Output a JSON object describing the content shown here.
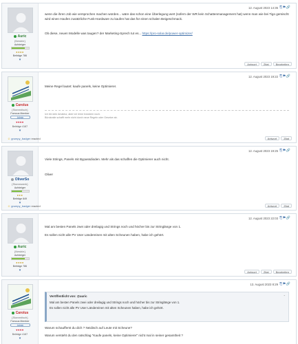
{
  "posts": [
    {
      "username": "Auric",
      "status_color": "#2e9e3b",
      "user_title": "{Newbie}",
      "rank_label": "Aufsteiger",
      "rank_fill": 0.75,
      "level": "Beiträge 786",
      "date": "12. August 2023 14:35",
      "text1": "wenn die ihren Job wie versprochen machen würden... wäre das schon eine Überlegung wert (sofern der WR kein Schattenmanagement hat) wenn man wie bei Tigo gemischt wird einen Haufen zusätzliche Funk-Hardware zu kaufen hat das für einen schalen Beigeschmack.",
      "text2": "Ob diese, neuen Modelle was taugen? der Marketing-Sprech tut es...",
      "link": "https://pro-solar.de/power-optimizer/",
      "actions": [
        "Antwort",
        "Zitat",
        "Bearbeiten"
      ]
    },
    {
      "username": "Carolus",
      "status_color": "#2e9e3b",
      "user_title": "{Stammtisch}",
      "rank_label": "Famous Member",
      "badge": "Admin",
      "level": "Beiträge 4187",
      "date": "12. August 2023 19:22",
      "text1": "Meine Regel lautet: kaufe panels, keine Optimierer.",
      "sig1": "Ich bin kein Amateur, aber ich lerne trotzdem noch.",
      "sig2": "Bürokratie schafft mehr nicht durch neue Regeln oder Gesetze ab.",
      "reacted_user": "grumpy_badger",
      "reacted_text": "reacted",
      "actions": [
        "Antwort",
        "Zitat"
      ]
    },
    {
      "username": "OliverSo",
      "status_color": "#9aa0a6",
      "user_title": "{Stammwerk}",
      "rank_label": "Aufsteiger",
      "rank_fill": 0.6,
      "level": "Beiträge 849",
      "date": "12. August 2023 19:25",
      "text1": "Viele Strings, Panels mit Bypassdioden. Mehr als das schaffen die Optimierer auch nicht.",
      "text2": "Oliver",
      "reacted_user": "grumpy_badger",
      "reacted_text": "reacted",
      "actions": [
        "Antwort",
        "Zitat"
      ]
    },
    {
      "username": "Auric",
      "status_color": "#2e9e3b",
      "user_title": "{Newbie}",
      "rank_label": "Aufsteiger",
      "rank_fill": 0.75,
      "level": "Beiträge 786",
      "date": "12. August 2023 22:03",
      "text1": "Mal am besten Panels zwei oder dreilagig und Strings noch und höcher bis zur Stringlänge von 1.",
      "text2": "Es sollen nicht alle PV User Ländereinen mit alten Scheunen haben, habe ich gehört.",
      "actions": [
        "Antwort",
        "Zitat",
        "Bearbeiten"
      ]
    },
    {
      "username": "Carolus",
      "status_color": "#2e9e3b",
      "user_title": "{Stammtisch}",
      "rank_label": "Famous Member",
      "badge": "Admin",
      "level": "Beiträge 4187",
      "date": "13. August 2023 8:29",
      "quote_head": "Veröffentlicht von: @auric",
      "quote1": "Mal am besten Panels zwei oder dreilagig und Strings noch und höcher bis zur Stringlänge von 1.",
      "quote2": "Es sollen nicht alle PV User Ländereinen mit alten Scheunen haben, habe ich gehört.",
      "text1": "Warum schaufferst du dich ? Neidisch auf Leute mit Scheune?",
      "text2": "Warum versteht du den ratschlag \"Kaufe panels, keine Optimierer\" nicht mal in seiner gesamtheit ?"
    }
  ]
}
